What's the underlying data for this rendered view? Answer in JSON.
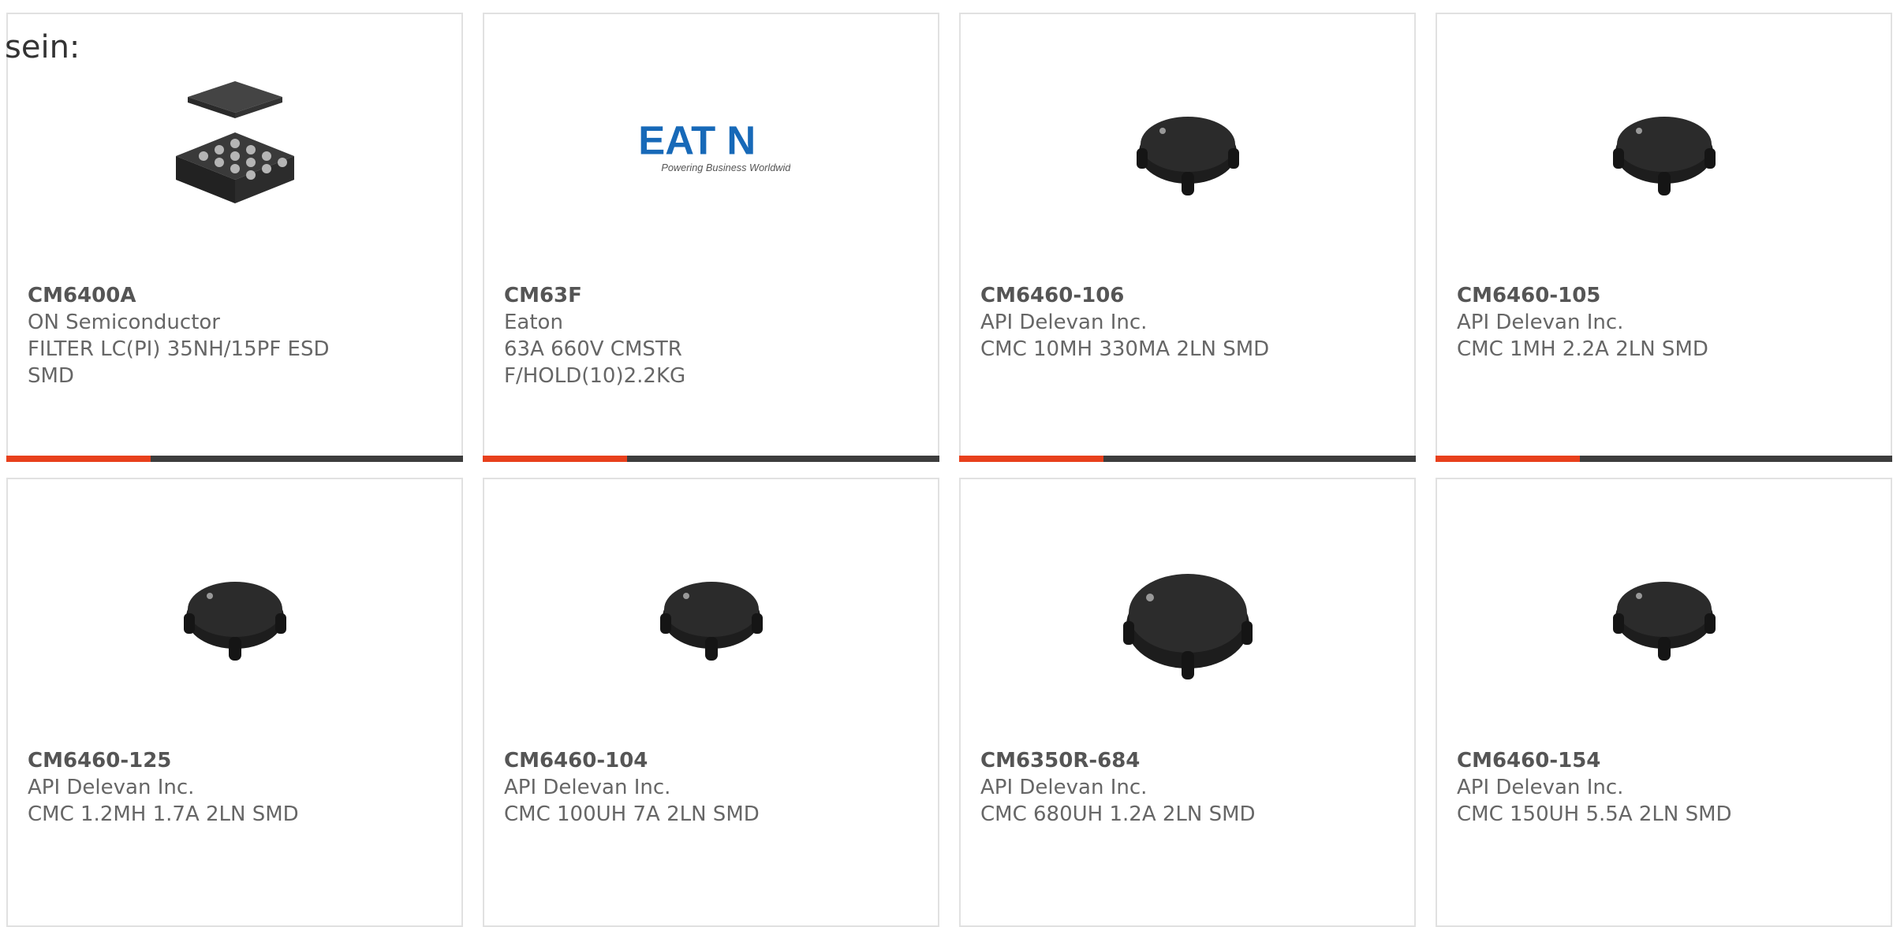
{
  "intro_text": "sein:",
  "colors": {
    "accent": "#e8401c",
    "bar": "#3d3d3d",
    "border": "#e1e1e1"
  },
  "products": [
    {
      "part": "CM6400A",
      "maker": "ON Semiconductor",
      "desc": "FILTER LC(PI) 35NH/15PF ESD SMD",
      "image": "chip-bga"
    },
    {
      "part": "CM63F",
      "maker": "Eaton",
      "desc": "63A 660V CMSTR F/HOLD(10)2.2KG",
      "image": "eaton-logo",
      "logo_text": "EAT N",
      "logo_tagline": "Powering Business Worldwide"
    },
    {
      "part": "CM6460-106",
      "maker": "API Delevan Inc.",
      "desc": "CMC 10MH 330MA 2LN SMD",
      "image": "choke-small"
    },
    {
      "part": "CM6460-105",
      "maker": "API Delevan Inc.",
      "desc": "CMC 1MH 2.2A 2LN SMD",
      "image": "choke-small"
    },
    {
      "part": "CM6460-125",
      "maker": "API Delevan Inc.",
      "desc": "CMC 1.2MH 1.7A 2LN SMD",
      "image": "choke-small"
    },
    {
      "part": "CM6460-104",
      "maker": "API Delevan Inc.",
      "desc": "CMC 100UH 7A 2LN SMD",
      "image": "choke-small"
    },
    {
      "part": "CM6350R-684",
      "maker": "API Delevan Inc.",
      "desc": "CMC 680UH 1.2A 2LN SMD",
      "image": "choke-large"
    },
    {
      "part": "CM6460-154",
      "maker": "API Delevan Inc.",
      "desc": "CMC 150UH 5.5A 2LN SMD",
      "image": "choke-small"
    }
  ]
}
